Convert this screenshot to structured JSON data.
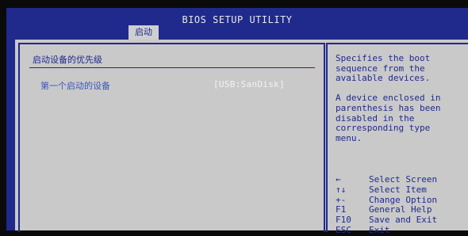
{
  "header": {
    "title": "BIOS SETUP UTILITY",
    "active_tab": "启动"
  },
  "main": {
    "section_title": "启动设备的优先级",
    "options": [
      {
        "label": "第一个启动的设备",
        "value": "[USB:SanDisk]"
      }
    ]
  },
  "help": {
    "paragraph1": "Specifies the boot\nsequence from the\navailable devices.",
    "paragraph2": "A device enclosed in\nparenthesis has been\ndisabled in the\ncorresponding type\nmenu.",
    "keys": [
      {
        "key": "←",
        "desc": "Select Screen"
      },
      {
        "key": "↑↓",
        "desc": "Select Item"
      },
      {
        "key": "+-",
        "desc": "Change Option"
      },
      {
        "key": "F1",
        "desc": "General Help"
      },
      {
        "key": "F10",
        "desc": "Save and Exit"
      },
      {
        "key": "ESC",
        "desc": "Exit"
      }
    ]
  }
}
